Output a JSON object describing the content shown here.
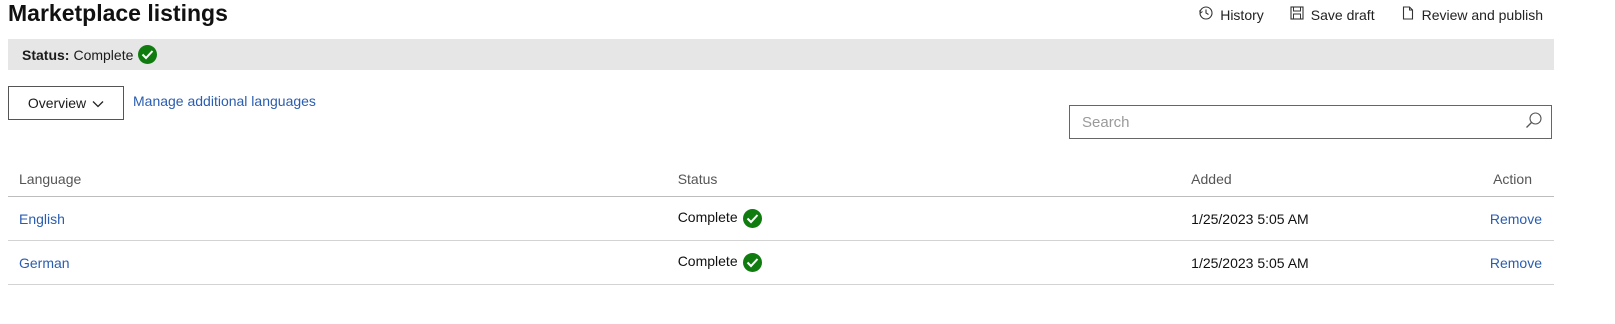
{
  "page": {
    "title": "Marketplace listings"
  },
  "toolbar": {
    "history_label": "History",
    "save_draft_label": "Save draft",
    "review_publish_label": "Review and publish"
  },
  "status_bar": {
    "label": "Status:",
    "value": "Complete"
  },
  "controls": {
    "dropdown_label": "Overview",
    "manage_link": "Manage additional languages",
    "search_placeholder": "Search"
  },
  "table": {
    "headers": {
      "language": "Language",
      "status": "Status",
      "added": "Added",
      "action": "Action"
    },
    "rows": [
      {
        "language": "English",
        "status": "Complete",
        "added": "1/25/2023 5:05 AM",
        "action": "Remove"
      },
      {
        "language": "German",
        "status": "Complete",
        "added": "1/25/2023 5:05 AM",
        "action": "Remove"
      }
    ]
  },
  "colors": {
    "success": "#107c10",
    "link": "#2a5db0",
    "status_bar_bg": "#e6e6e6"
  },
  "icons": [
    "history-icon",
    "save-icon",
    "document-icon",
    "check-icon",
    "chevron-down-icon",
    "search-icon"
  ]
}
